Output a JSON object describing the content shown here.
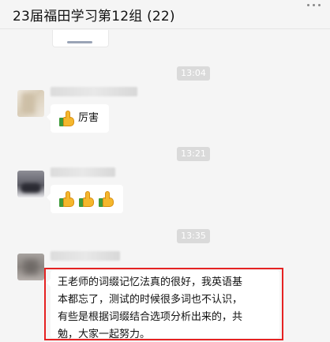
{
  "header": {
    "title": "23届福田学习第12组 (22)",
    "more_icon": "more-horizontal-icon"
  },
  "messages": [
    {
      "type": "time",
      "text": "13:04"
    },
    {
      "type": "text",
      "avatar": "blurred-avatar",
      "text": "厉害",
      "emoji": [
        "thumbs-up-icon"
      ]
    },
    {
      "type": "time",
      "text": "13:21"
    },
    {
      "type": "emoji",
      "avatar": "blurred-avatar",
      "emoji": [
        "thumbs-up-icon",
        "thumbs-up-icon",
        "thumbs-up-icon"
      ]
    },
    {
      "type": "time",
      "text": "13:35"
    },
    {
      "type": "text",
      "avatar": "blurred-avatar",
      "highlighted": true,
      "lines": [
        "王老师的词缀记忆法真的很好，我英语基",
        "本都忘了，测试的时候很多词也不认识，",
        "有些是根据词缀结合选项分析出来的，共",
        "勉，大家一起努力。"
      ]
    }
  ],
  "colors": {
    "background": "#f5f5f5",
    "bubble": "#ffffff",
    "time_badge": "#dadada",
    "highlight_border": "#e52222"
  }
}
